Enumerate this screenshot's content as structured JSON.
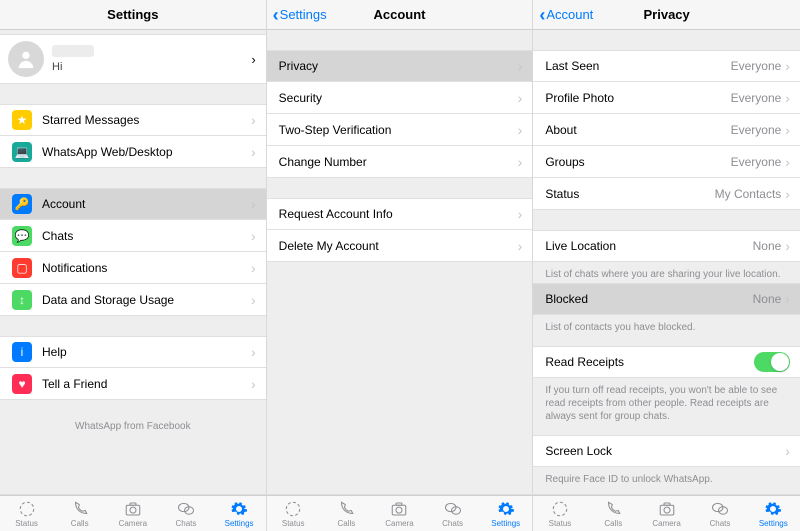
{
  "screen1": {
    "title": "Settings",
    "profile": {
      "status": "Hi"
    },
    "groups": {
      "g1": [
        {
          "name": "starred-messages",
          "label": "Starred Messages",
          "iconColor": "#ffcc00",
          "glyph": "★"
        },
        {
          "name": "whatsapp-web",
          "label": "WhatsApp Web/Desktop",
          "iconColor": "#18a998",
          "glyph": "💻"
        }
      ],
      "g2": [
        {
          "name": "account",
          "label": "Account",
          "iconColor": "#007aff",
          "glyph": "🔑",
          "selected": true
        },
        {
          "name": "chats",
          "label": "Chats",
          "iconColor": "#4cd964",
          "glyph": "💬"
        },
        {
          "name": "notifications",
          "label": "Notifications",
          "iconColor": "#ff3b30",
          "glyph": "▢"
        },
        {
          "name": "data-storage",
          "label": "Data and Storage Usage",
          "iconColor": "#4cd964",
          "glyph": "↕"
        }
      ],
      "g3": [
        {
          "name": "help",
          "label": "Help",
          "iconColor": "#007aff",
          "glyph": "i"
        },
        {
          "name": "tell-a-friend",
          "label": "Tell a Friend",
          "iconColor": "#ff2d55",
          "glyph": "♥"
        }
      ]
    },
    "footer": "WhatsApp from Facebook"
  },
  "screen2": {
    "back": "Settings",
    "title": "Account",
    "groups": {
      "g1": [
        {
          "name": "privacy",
          "label": "Privacy",
          "selected": true
        },
        {
          "name": "security",
          "label": "Security"
        },
        {
          "name": "two-step",
          "label": "Two-Step Verification"
        },
        {
          "name": "change-number",
          "label": "Change Number"
        }
      ],
      "g2": [
        {
          "name": "request-info",
          "label": "Request Account Info"
        },
        {
          "name": "delete-account",
          "label": "Delete My Account"
        }
      ]
    }
  },
  "screen3": {
    "back": "Account",
    "title": "Privacy",
    "rows": {
      "lastSeen": {
        "label": "Last Seen",
        "value": "Everyone"
      },
      "profilePhoto": {
        "label": "Profile Photo",
        "value": "Everyone"
      },
      "about": {
        "label": "About",
        "value": "Everyone"
      },
      "groups": {
        "label": "Groups",
        "value": "Everyone"
      },
      "status": {
        "label": "Status",
        "value": "My Contacts"
      },
      "liveLocation": {
        "label": "Live Location",
        "value": "None"
      },
      "blocked": {
        "label": "Blocked",
        "value": "None"
      },
      "readReceipts": {
        "label": "Read Receipts"
      },
      "screenLock": {
        "label": "Screen Lock"
      }
    },
    "footers": {
      "liveLocation": "List of chats where you are sharing your live location.",
      "blocked": "List of contacts you have blocked.",
      "readReceipts": "If you turn off read receipts, you won't be able to see read receipts from other people. Read receipts are always sent for group chats.",
      "screenLock": "Require Face ID to unlock WhatsApp."
    }
  },
  "tabbar": {
    "items": [
      {
        "name": "status",
        "label": "Status"
      },
      {
        "name": "calls",
        "label": "Calls"
      },
      {
        "name": "camera",
        "label": "Camera"
      },
      {
        "name": "chats",
        "label": "Chats"
      },
      {
        "name": "settings",
        "label": "Settings",
        "active": true
      }
    ]
  }
}
